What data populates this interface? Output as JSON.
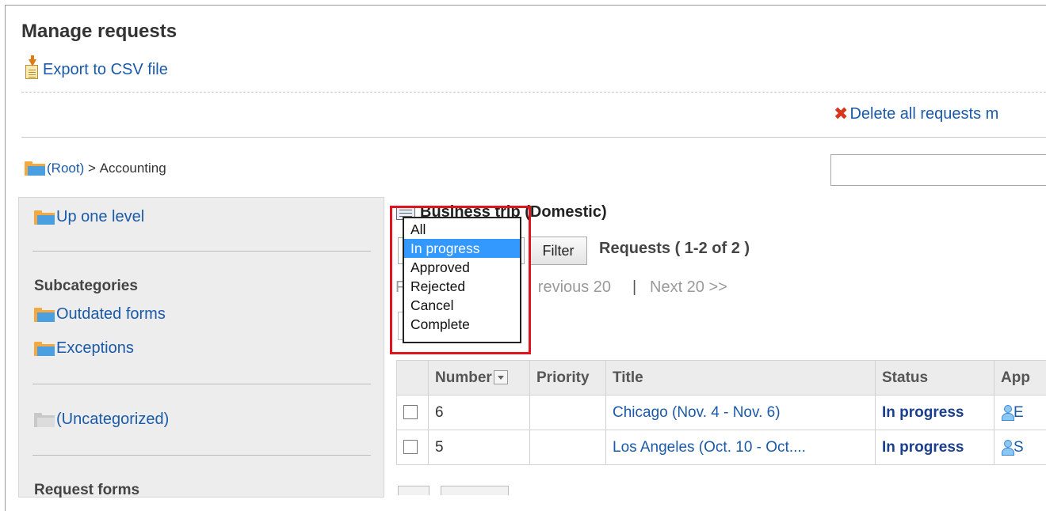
{
  "page": {
    "title": "Manage requests"
  },
  "toolbar": {
    "export_label": "Export to CSV file",
    "delete_label": "Delete all requests m"
  },
  "breadcrumb": {
    "root": "(Root)",
    "separator": " > ",
    "current": "Accounting"
  },
  "search": {
    "value": ""
  },
  "sidebar": {
    "up_label": "Up one level",
    "subcategories_heading": "Subcategories",
    "subcategories": [
      {
        "label": "Outdated forms"
      },
      {
        "label": "Exceptions"
      }
    ],
    "uncategorized_label": "(Uncategorized)",
    "request_forms_heading": "Request forms"
  },
  "main": {
    "form_title": "Business trip (Domestic)",
    "filter_label": "Filter",
    "requests_count": "Requests ( 1-2 of 2 )",
    "pager_prev_fragment": "F",
    "pager_prev": "revious 20",
    "pager_sep": "|",
    "pager_next": "Next 20 >>"
  },
  "status_dropdown": {
    "options": [
      "All",
      "In progress",
      "Approved",
      "Rejected",
      "Cancel",
      "Complete"
    ],
    "selected": "In progress"
  },
  "table": {
    "headers": {
      "number": "Number",
      "priority": "Priority",
      "title": "Title",
      "status": "Status",
      "applicant": "App"
    },
    "rows": [
      {
        "number": "6",
        "priority": "",
        "title": "Chicago (Nov. 4 - Nov. 6)",
        "status": "In progress",
        "applicant": "E"
      },
      {
        "number": "5",
        "priority": "",
        "title": "Los Angeles (Oct. 10 - Oct....",
        "status": "In progress",
        "applicant": "S"
      }
    ]
  },
  "colors": {
    "link": "#1a5aa8",
    "status": "#1a3f8f",
    "highlight": "#e0141b",
    "selection": "#3399ff"
  }
}
